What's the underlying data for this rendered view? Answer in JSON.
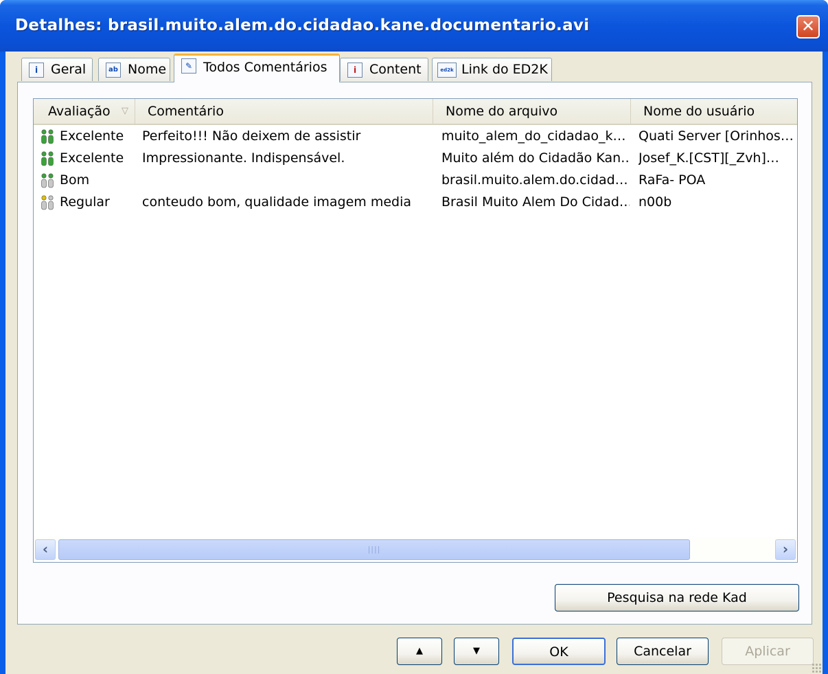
{
  "window": {
    "title": "Detalhes: brasil.muito.alem.do.cidadao.kane.documentario.avi",
    "close_glyph": "✕"
  },
  "tabs": [
    {
      "label": "Geral",
      "icon": "info-doc-icon",
      "glyph": "i"
    },
    {
      "label": "Nome",
      "icon": "name-doc-icon",
      "glyph": "ab"
    },
    {
      "label": "Todos Comentários",
      "icon": "comments-pen-icon",
      "glyph": "✎",
      "active": true
    },
    {
      "label": "Content",
      "icon": "content-doc-icon",
      "glyph": "i"
    },
    {
      "label": "Link do ED2K",
      "icon": "ed2k-link-icon",
      "glyph": "ed2k"
    }
  ],
  "list": {
    "columns": [
      "Avaliação",
      "Comentário",
      "Nome do arquivo",
      "Nome do usuário"
    ],
    "sort_glyph": "▽",
    "rows": [
      {
        "rating": "Excelente",
        "comment": "Perfeito!!! Não deixem de assistir",
        "filename": "muito_alem_do_cidadao_k…",
        "user": "Quati Server [Orinhos…",
        "level": 4
      },
      {
        "rating": "Excelente",
        "comment": "Impressionante. Indispensável.",
        "filename": "Muito além do Cidadão Kan…",
        "user": "Josef_K.[CST][_Zvh]…",
        "level": 4
      },
      {
        "rating": "Bom",
        "comment": "",
        "filename": "brasil.muito.alem.do.cidad…",
        "user": "RaFa- POA",
        "level": 2
      },
      {
        "rating": "Regular",
        "comment": "conteudo bom, qualidade imagem media",
        "filename": "Brasil Muito Alem Do Cidad…",
        "user": "n00b",
        "level": 1
      }
    ],
    "scroll_left_glyph": "‹",
    "scroll_right_glyph": "›",
    "thumb_grip": "||||"
  },
  "search_button": "Pesquisa na rede Kad",
  "buttons": {
    "up_glyph": "▲",
    "down_glyph": "▼",
    "ok": "OK",
    "cancel": "Cancelar",
    "apply": "Aplicar"
  },
  "colors": {
    "titlebar": "#0a55dc",
    "dialog_bg": "#ece9d8",
    "rating_green": "#3aa33a",
    "rating_gray": "#c8c8c8",
    "rating_yellow": "#e0c000"
  }
}
